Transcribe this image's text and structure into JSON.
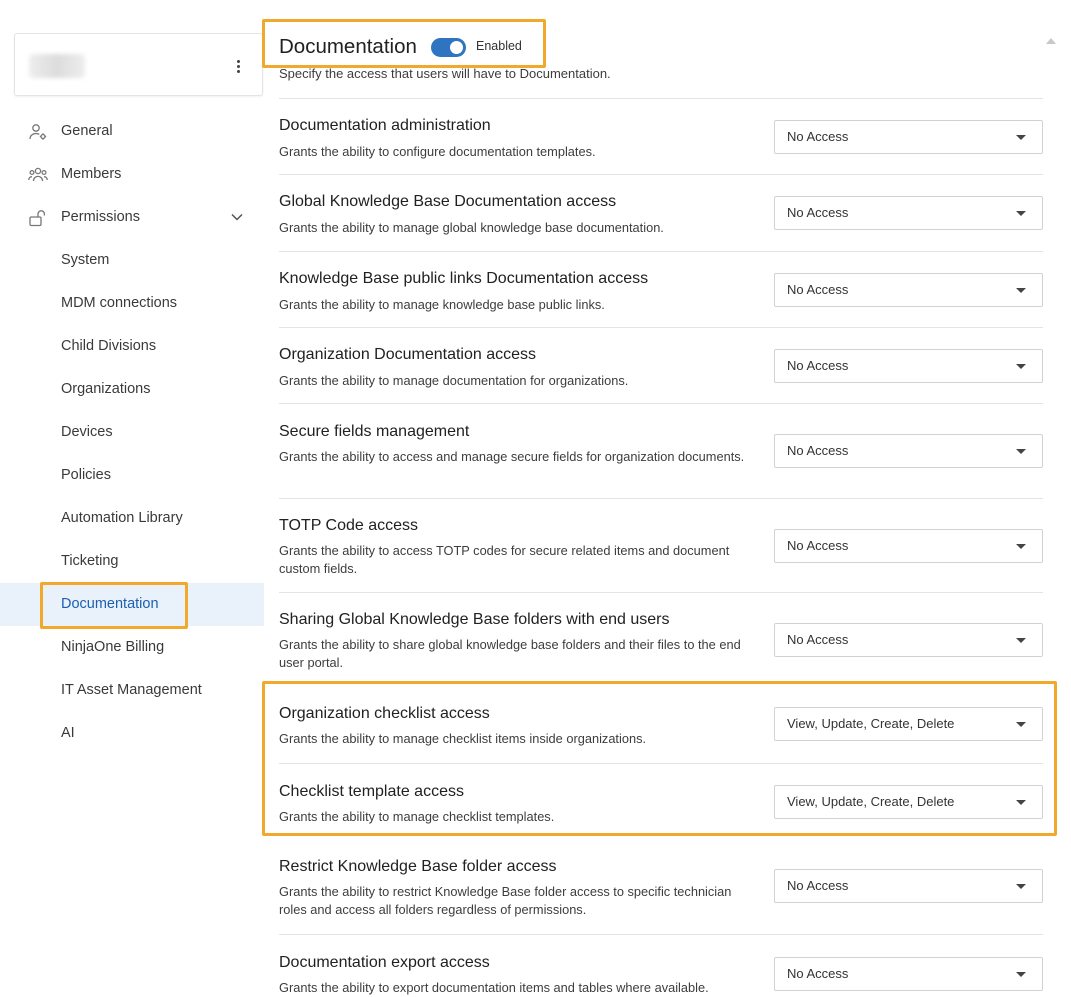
{
  "sidebar": {
    "menu_icon": "kebab-menu-icon",
    "items": [
      {
        "label": "General",
        "icon": "user-gear-icon"
      },
      {
        "label": "Members",
        "icon": "users-icon"
      },
      {
        "label": "Permissions",
        "icon": "lock-open-icon",
        "expanded": true
      }
    ],
    "sub_items": [
      {
        "label": "System"
      },
      {
        "label": "MDM connections"
      },
      {
        "label": "Child Divisions"
      },
      {
        "label": "Organizations"
      },
      {
        "label": "Devices"
      },
      {
        "label": "Policies"
      },
      {
        "label": "Automation Library"
      },
      {
        "label": "Ticketing"
      },
      {
        "label": "Documentation",
        "active": true
      },
      {
        "label": "NinjaOne Billing"
      },
      {
        "label": "IT Asset Management"
      },
      {
        "label": "AI"
      }
    ]
  },
  "header": {
    "title": "Documentation",
    "toggle_label": "Enabled",
    "enabled": true,
    "description": "Specify the access that users will have to Documentation."
  },
  "permissions": [
    {
      "title": "Documentation administration",
      "description": "Grants the ability to configure documentation templates.",
      "value": "No Access"
    },
    {
      "title": "Global Knowledge Base Documentation access",
      "description": "Grants the ability to manage global knowledge base documentation.",
      "value": "No Access"
    },
    {
      "title": "Knowledge Base public links Documentation access",
      "description": "Grants the ability to manage knowledge base public links.",
      "value": "No Access"
    },
    {
      "title": "Organization Documentation access",
      "description": "Grants the ability to manage documentation for organizations.",
      "value": "No Access"
    },
    {
      "title": "Secure fields management",
      "description": "Grants the ability to access and manage secure fields for organization documents.",
      "value": "No Access"
    },
    {
      "title": "TOTP Code access",
      "description": "Grants the ability to access TOTP codes for secure related items and document custom fields.",
      "value": "No Access"
    },
    {
      "title": "Sharing Global Knowledge Base folders with end users",
      "description": "Grants the ability to share global knowledge base folders and their files to the end user portal.",
      "value": "No Access"
    },
    {
      "title": "Organization checklist access",
      "description": "Grants the ability to manage checklist items inside organizations.",
      "value": "View, Update, Create, Delete"
    },
    {
      "title": "Checklist template access",
      "description": "Grants the ability to manage checklist templates.",
      "value": "View, Update, Create, Delete"
    },
    {
      "title": "Restrict Knowledge Base folder access",
      "description": "Grants the ability to restrict Knowledge Base folder access to specific technician roles and access all folders regardless of permissions.",
      "value": "No Access"
    },
    {
      "title": "Documentation export access",
      "description": "Grants the ability to export documentation items and tables where available.",
      "value": "No Access"
    }
  ],
  "colors": {
    "accent": "#2f74c0",
    "highlight": "#f0a92a",
    "active_bg": "#e9f1fa"
  }
}
